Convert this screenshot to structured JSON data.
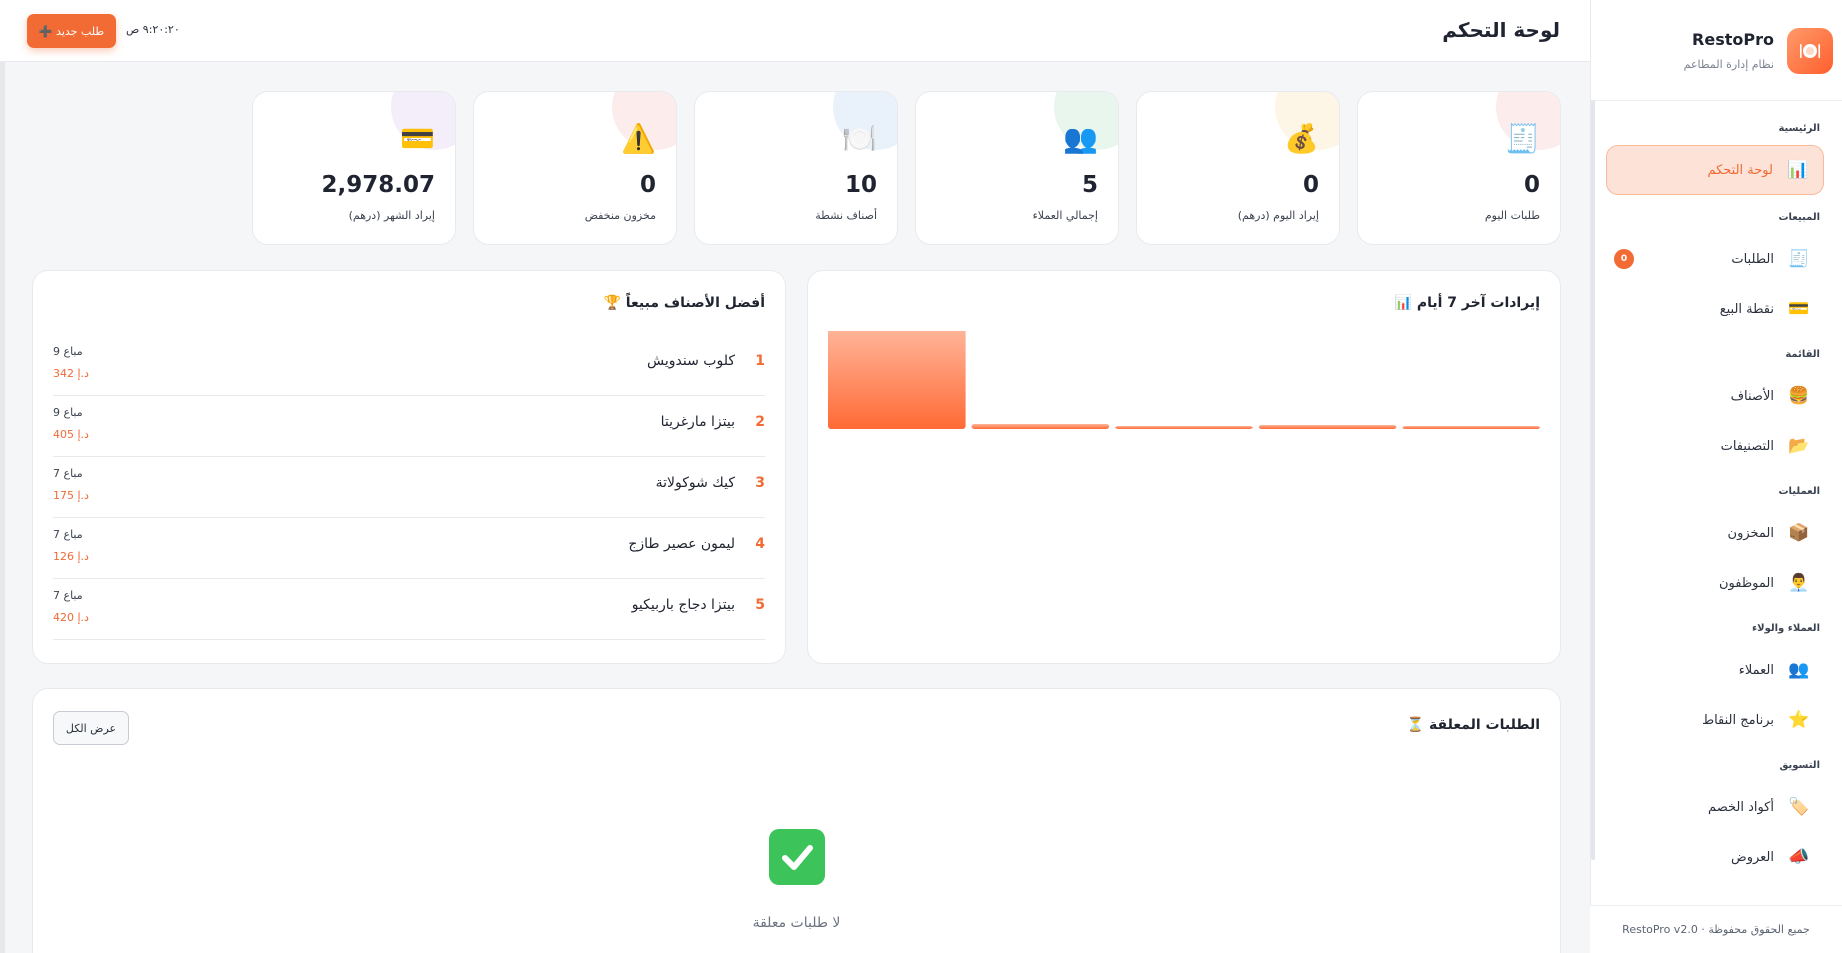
{
  "brand": {
    "name": "RestoPro",
    "subtitle": "نظام إدارة المطاعم"
  },
  "header": {
    "title": "لوحة التحكم",
    "clock": "٩:٢٠:٢٠ ص",
    "new_order_label": "➕ طلب جديد"
  },
  "sidebar": {
    "sections": [
      "الرئيسية",
      "المبيعات",
      "القائمة",
      "العمليات",
      "العملاء والولاء",
      "التسويق"
    ],
    "items": [
      {
        "label": "لوحة التحكم",
        "icon": "📊",
        "icon_name": "chart-icon"
      },
      {
        "label": "الطلبات",
        "icon": "🧾",
        "icon_name": "receipt-icon",
        "badge": "0"
      },
      {
        "label": "نقطة البيع",
        "icon": "💳",
        "icon_name": "card-icon"
      },
      {
        "label": "الأصناف",
        "icon": "🍔",
        "icon_name": "burger-icon"
      },
      {
        "label": "التصنيفات",
        "icon": "📂",
        "icon_name": "folder-icon"
      },
      {
        "label": "المخزون",
        "icon": "📦",
        "icon_name": "box-icon"
      },
      {
        "label": "الموظفون",
        "icon": "👨‍💼",
        "icon_name": "staff-icon"
      },
      {
        "label": "العملاء",
        "icon": "👥",
        "icon_name": "customers-icon"
      },
      {
        "label": "برنامج النقاط",
        "icon": "⭐",
        "icon_name": "star-icon"
      },
      {
        "label": "أكواد الخصم",
        "icon": "🏷️",
        "icon_name": "tag-icon"
      },
      {
        "label": "العروض",
        "icon": "📣",
        "icon_name": "megaphone-icon"
      }
    ],
    "footer": "RestoPro v2.0 · جميع الحقوق محفوظة"
  },
  "stats": [
    {
      "label": "طلبات اليوم",
      "value": "0",
      "icon": "🧾",
      "icon_name": "receipt-icon",
      "blob": "#fdecec"
    },
    {
      "label": "إيراد اليوم (درهم)",
      "value": "0",
      "icon": "💰",
      "icon_name": "money-bag-icon",
      "blob": "#fdf5e6"
    },
    {
      "label": "إجمالي العملاء",
      "value": "5",
      "icon": "👥",
      "icon_name": "customers-icon",
      "blob": "#e8f6ee"
    },
    {
      "label": "أصناف نشطة",
      "value": "10",
      "icon": "🍽️",
      "icon_name": "plate-icon",
      "blob": "#e9f1fb"
    },
    {
      "label": "مخزون منخفض",
      "value": "0",
      "icon": "⚠️",
      "icon_name": "warning-icon",
      "blob": "#fdecec"
    },
    {
      "label": "إيراد الشهر (درهم)",
      "value": "2,978.07",
      "icon": "💳",
      "icon_name": "card-icon",
      "blob": "#f3eefa"
    }
  ],
  "chart_panel": {
    "title": "📊 إيرادات آخر 7 أيام"
  },
  "chart_data": {
    "type": "bar",
    "values": [
      100,
      5,
      3,
      4,
      3
    ],
    "colors": {
      "top": "#ffb59a",
      "bottom": "#ff6a35"
    }
  },
  "top_items": {
    "title": "🏆 أفضل الأصناف مبيعاً",
    "items": [
      {
        "rank": "1",
        "name": "كلوب سندويش",
        "sold": "9 مباع",
        "amount": "342 د.إ"
      },
      {
        "rank": "2",
        "name": "بيتزا مارغريتا",
        "sold": "9 مباع",
        "amount": "405 د.إ"
      },
      {
        "rank": "3",
        "name": "كيك شوكولاتة",
        "sold": "7 مباع",
        "amount": "175 د.إ"
      },
      {
        "rank": "4",
        "name": "ليمون عصير طازج",
        "sold": "7 مباع",
        "amount": "126 د.إ"
      },
      {
        "rank": "5",
        "name": "بيتزا دجاج باربيكيو",
        "sold": "7 مباع",
        "amount": "420 د.إ"
      }
    ]
  },
  "pending": {
    "title": "⏳ الطلبات المعلقة",
    "view_all_label": "عرض الكل",
    "empty_text": "لا طلبات معلقة"
  },
  "theme": {
    "accent": "#f26b35",
    "success": "#3cc45a"
  }
}
